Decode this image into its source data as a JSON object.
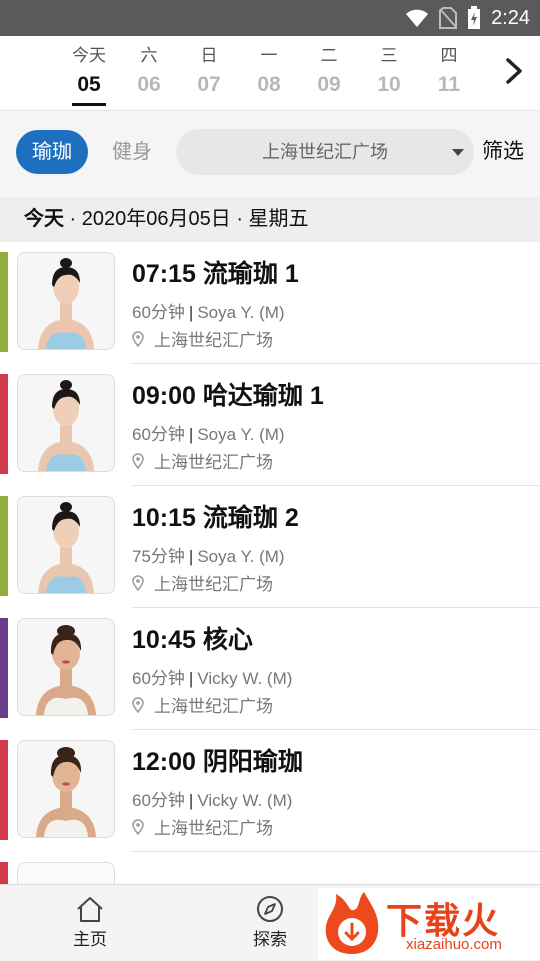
{
  "status_bar": {
    "time": "2:24"
  },
  "date_strip": {
    "days": [
      {
        "weekday": "今天",
        "date": "05",
        "active": true
      },
      {
        "weekday": "六",
        "date": "06"
      },
      {
        "weekday": "日",
        "date": "07"
      },
      {
        "weekday": "一",
        "date": "08"
      },
      {
        "weekday": "二",
        "date": "09"
      },
      {
        "weekday": "三",
        "date": "10"
      },
      {
        "weekday": "四",
        "date": "11"
      }
    ]
  },
  "filters": {
    "category_yoga": "瑜珈",
    "category_fitness": "健身",
    "location_selected": "上海世纪汇广场",
    "filter_label": "筛选"
  },
  "date_header": {
    "today": "今天",
    "rest": " · 2020年06月05日 · 星期五"
  },
  "classes": [
    {
      "time_title": "07:15 流瑜珈 1",
      "duration": "60分钟",
      "instructor": "Soya Y. (M)",
      "location": "上海世纪汇广场",
      "color": "#8fae3a"
    },
    {
      "time_title": "09:00 哈达瑜珈 1",
      "duration": "60分钟",
      "instructor": "Soya Y. (M)",
      "location": "上海世纪汇广场",
      "color": "#d2394b"
    },
    {
      "time_title": "10:15 流瑜珈 2",
      "duration": "75分钟",
      "instructor": "Soya Y. (M)",
      "location": "上海世纪汇广场",
      "color": "#8fae3a"
    },
    {
      "time_title": "10:45 核心",
      "duration": "60分钟",
      "instructor": "Vicky W. (M)",
      "location": "上海世纪汇广场",
      "color": "#6a3d8a"
    },
    {
      "time_title": "12:00 阴阳瑜珈",
      "duration": "60分钟",
      "instructor": "Vicky W. (M)",
      "location": "上海世纪汇广场",
      "color": "#d2394b"
    }
  ],
  "bottom_nav": {
    "home": "主页",
    "explore": "探索"
  },
  "watermark": {
    "brand": "下载火",
    "url": "xiazaihuo.com"
  },
  "colors": {
    "accent": "#1f6fbf"
  }
}
